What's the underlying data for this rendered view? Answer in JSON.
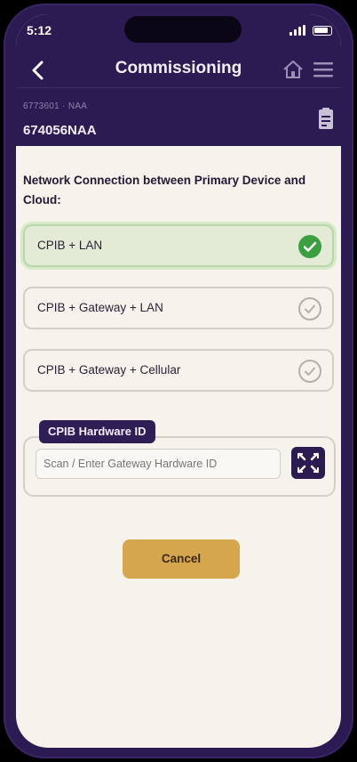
{
  "status_bar": {
    "time": "5:12",
    "icons": [
      "signal-icon",
      "battery-icon"
    ]
  },
  "header": {
    "title": "Commissioning",
    "back_icon": "chevron-left-icon",
    "home_icon": "home-icon",
    "menu_icon": "hamburger-menu-icon",
    "device_sub": "6773601 · NAA",
    "device_id": "674056NAA",
    "doc_icon": "document-icon"
  },
  "question": "Network Connection between Primary Device and Cloud:",
  "options": [
    {
      "label": "CPIB + LAN",
      "selected": true
    },
    {
      "label": "CPIB + Gateway + LAN",
      "selected": false
    },
    {
      "label": "CPIB + Gateway + Cellular",
      "selected": false
    }
  ],
  "hardware": {
    "label": "CPIB Hardware ID",
    "placeholder": "Scan / Enter Gateway Hardware ID",
    "value": "",
    "scan_icon": "qr-scan-icon"
  },
  "cancel_label": "Cancel",
  "colors": {
    "primary": "#2c1a52",
    "accent": "#d6a64c",
    "success": "#3a9f3e",
    "selected_bg": "#e3ead6",
    "background": "#f6f3ec"
  }
}
